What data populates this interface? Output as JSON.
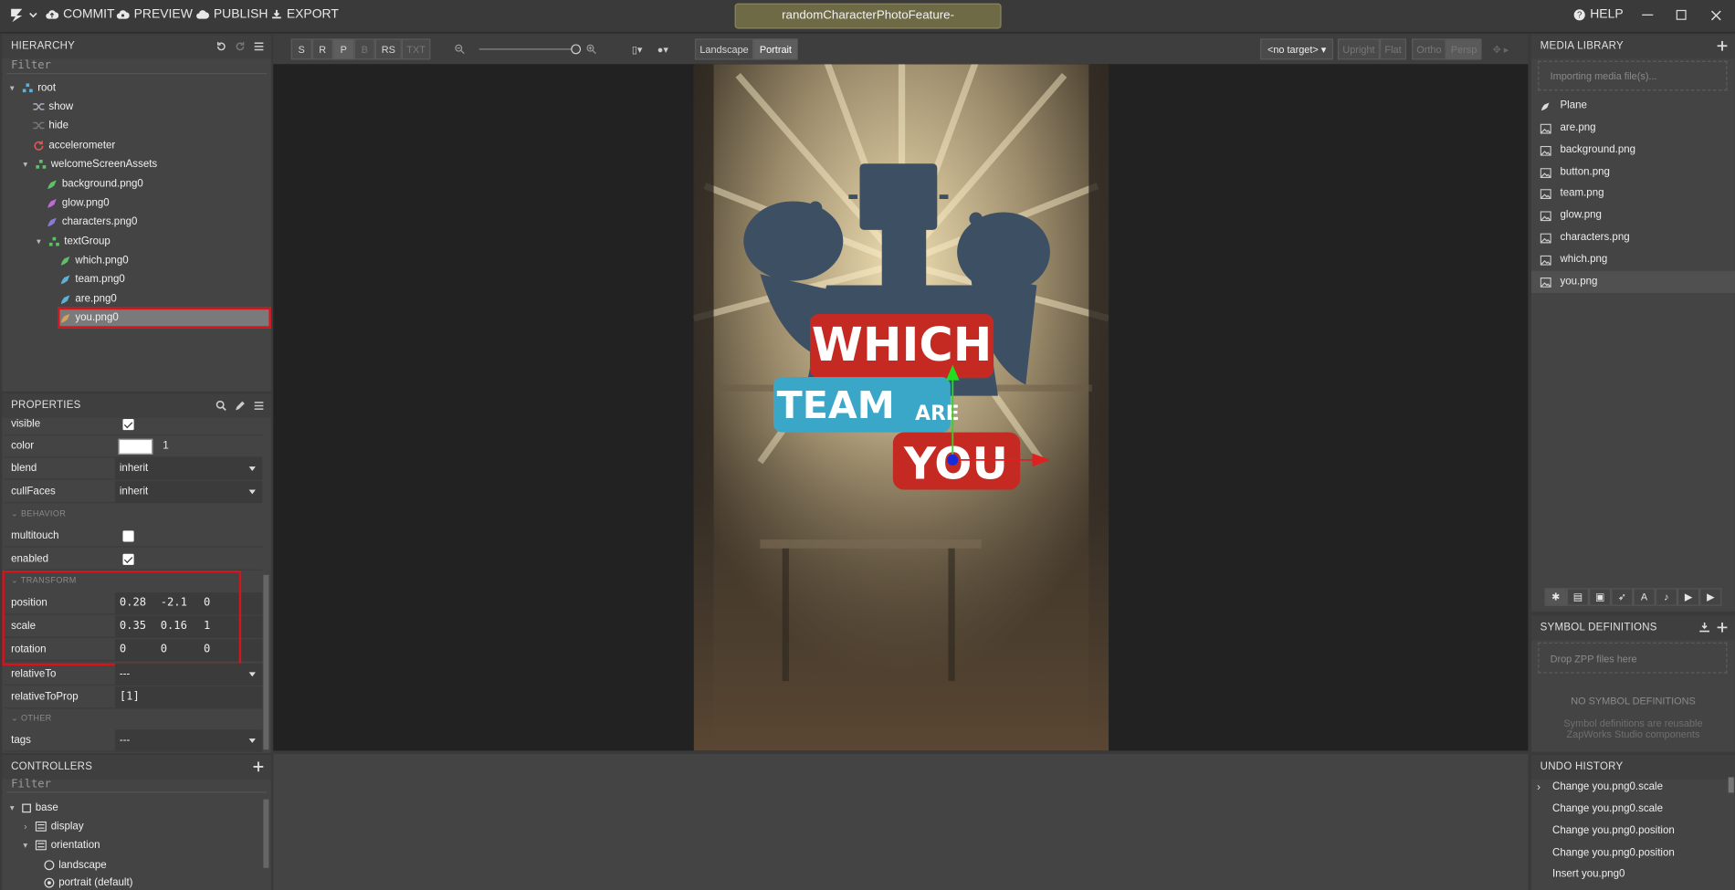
{
  "topbar": {
    "commit": "COMMIT",
    "preview": "PREVIEW",
    "publish": "PUBLISH",
    "export": "EXPORT",
    "project": "randomCharacterPhotoFeature-",
    "help": "HELP"
  },
  "hierarchy": {
    "title": "HIERARCHY",
    "filter_placeholder": "Filter",
    "items": [
      {
        "label": "root",
        "icon": "group-icon"
      },
      {
        "label": "show",
        "icon": "shuffle-icon"
      },
      {
        "label": "hide",
        "icon": "shuffle-icon"
      },
      {
        "label": "accelerometer",
        "icon": "refresh-icon"
      },
      {
        "label": "welcomeScreenAssets",
        "icon": "group-icon"
      },
      {
        "label": "background.png0",
        "icon": "rocket-icon"
      },
      {
        "label": "glow.png0",
        "icon": "rocket-icon"
      },
      {
        "label": "characters.png0",
        "icon": "rocket-icon"
      },
      {
        "label": "textGroup",
        "icon": "group-icon"
      },
      {
        "label": "which.png0",
        "icon": "rocket-icon"
      },
      {
        "label": "team.png0",
        "icon": "rocket-icon"
      },
      {
        "label": "are.png0",
        "icon": "rocket-icon"
      },
      {
        "label": "you.png0",
        "icon": "rocket-icon",
        "selected": true
      }
    ]
  },
  "properties": {
    "title": "PROPERTIES",
    "visible": "visible",
    "color": "color",
    "color_value": "1",
    "blend": "blend",
    "blend_value": "inherit",
    "cullFaces": "cullFaces",
    "cullFaces_value": "inherit",
    "behavior_section": "BEHAVIOR",
    "multitouch": "multitouch",
    "enabled": "enabled",
    "transform_section": "TRANSFORM",
    "position": "position",
    "position_values": [
      "0.28",
      "-2.1",
      "0"
    ],
    "scale": "scale",
    "scale_values": [
      "0.35",
      "0.16",
      "1"
    ],
    "rotation": "rotation",
    "rotation_values": [
      "0",
      "0",
      "0"
    ],
    "relativeTo": "relativeTo",
    "relativeTo_value": "---",
    "relativeToProp": "relativeToProp",
    "relativeToProp_value": "[1]",
    "other_section": "OTHER",
    "tags": "tags",
    "tags_value": "---"
  },
  "controllers": {
    "title": "CONTROLLERS",
    "filter_placeholder": "Filter",
    "items": [
      "base",
      "display",
      "orientation",
      "landscape",
      "portrait (default)"
    ]
  },
  "viewport": {
    "modes": [
      "S",
      "R",
      "P",
      "B",
      "RS",
      "TXT"
    ],
    "landscape": "Landscape",
    "portrait": "Portrait",
    "target": "<no target>",
    "views": [
      "Upright",
      "Flat",
      "Ortho",
      "Persp"
    ],
    "art": {
      "which": "WHICH",
      "team": "TEAM",
      "are": "ARE",
      "you": "YOU"
    }
  },
  "media": {
    "title": "MEDIA LIBRARY",
    "importing": "Importing media file(s)...",
    "items": [
      {
        "label": "Plane",
        "icon": "rocket-icon"
      },
      {
        "label": "are.png",
        "icon": "image-icon"
      },
      {
        "label": "background.png",
        "icon": "image-icon"
      },
      {
        "label": "button.png",
        "icon": "image-icon"
      },
      {
        "label": "team.png",
        "icon": "image-icon"
      },
      {
        "label": "glow.png",
        "icon": "image-icon"
      },
      {
        "label": "characters.png",
        "icon": "image-icon"
      },
      {
        "label": "which.png",
        "icon": "image-icon"
      },
      {
        "label": "you.png",
        "icon": "image-icon"
      }
    ]
  },
  "symbols": {
    "title": "SYMBOL DEFINITIONS",
    "drop": "Drop ZPP files here",
    "none": "NO SYMBOL DEFINITIONS",
    "desc1": "Symbol definitions are reusable",
    "desc2": "ZapWorks Studio components"
  },
  "undo": {
    "title": "UNDO HISTORY",
    "items": [
      "Change you.png0.scale",
      "Change you.png0.scale",
      "Change you.png0.position",
      "Change you.png0.position",
      "Insert you.png0"
    ]
  },
  "colors": {
    "accent_red": "#d7141a",
    "project_bg": "#6e6a46"
  }
}
